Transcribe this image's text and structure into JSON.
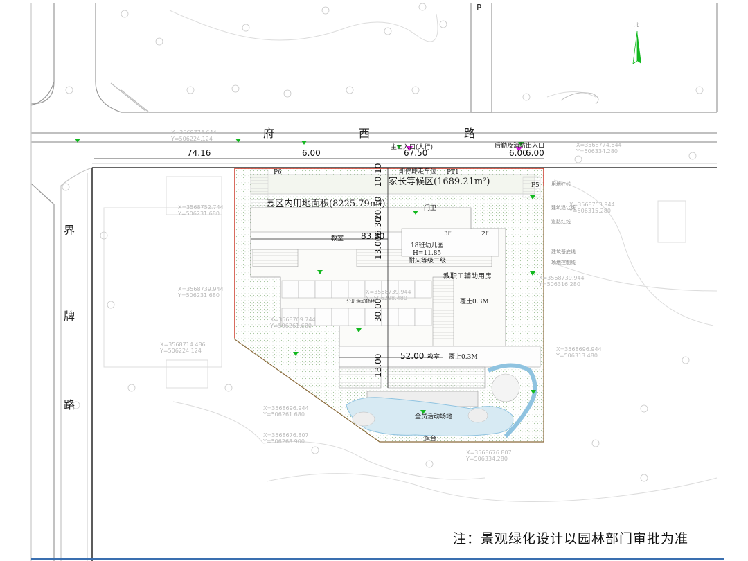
{
  "roads": {
    "fuxi": [
      "府",
      "西",
      "路"
    ],
    "jiepai": [
      "界",
      "牌",
      "路"
    ]
  },
  "parking_mark": "P",
  "north_mark": "北",
  "areas": {
    "parent_wait": "家长等候区(1689.21m²)",
    "site_area": "园区内用地面积(8225.79m²)",
    "kindergarten": [
      "18班幼儿园",
      "H=11.85",
      "耐火等级二级"
    ],
    "staff_rooms": "教职工辅助用房",
    "all_activity": "全员活动场地",
    "flag_stage": "旗台",
    "class_activity": "分班活动场地",
    "guard": "门卫",
    "soil_1": "覆土0.3M",
    "soil_2": "覆上0.3M",
    "classroom_1": "教室",
    "classroom_2": "教室",
    "floor_3f": "3F",
    "floor_2f": "2F",
    "drop_off": "即停即走车位",
    "p6": "P6",
    "pt1": "PT1",
    "p5": "P5"
  },
  "entrances": {
    "main": "主出入口(人行)",
    "rear": "后勤及消防出入口"
  },
  "dimensions": {
    "d_7416": "74.16",
    "d_600a": "6.00",
    "d_6750": "67.50",
    "d_600b": "6.00",
    "d_600c": "6.00",
    "d_8380": "83.80",
    "d_5200": "52.00",
    "d_1310": "10.10",
    "d_2010": "20.10",
    "d_630": "6.30",
    "d_1300a": "13.00",
    "d_3000": "30.00",
    "d_1300b": "13.00"
  },
  "coordinates": {
    "c1": [
      "X=3568774.644",
      "Y=506224.124"
    ],
    "c2": [
      "X=3568774.644",
      "Y=506334.280"
    ],
    "c3": [
      "X=3568752.744",
      "Y=506231.680"
    ],
    "c4": [
      "X=3568753.944",
      "Y=506315.280"
    ],
    "c5": [
      "X=3568739.944",
      "Y=506231.680"
    ],
    "c6": [
      "X=3568739.944",
      "Y=506316.280"
    ],
    "c7": [
      "X=3568709.744",
      "Y=506261.680"
    ],
    "c8": [
      "X=3568714.486",
      "Y=506224.124"
    ],
    "c9": [
      "X=3568696.944",
      "Y=506313.480"
    ],
    "c10": [
      "X=3568696.944",
      "Y=506261.680"
    ],
    "c11": [
      "X=3568676.807",
      "Y=506268.900"
    ],
    "c12": [
      "X=3568676.807",
      "Y=506334.280"
    ],
    "c13": [
      "X=3568739.944",
      "Y=506298.480"
    ]
  },
  "legend_small": [
    "用地红线",
    "建筑退让线",
    "道路红线",
    "建筑基底线",
    "场地控制线"
  ],
  "note": "注：景观绿化设计以园林部门审批为准",
  "colors": {
    "site_boundary": "#d23a2c",
    "wall_line": "#8a6a3a",
    "marker": "#12b81f",
    "marker_magenta": "#d21fd2",
    "water": "#8fc3e0",
    "bottom_rule": "#3a6fb0"
  }
}
